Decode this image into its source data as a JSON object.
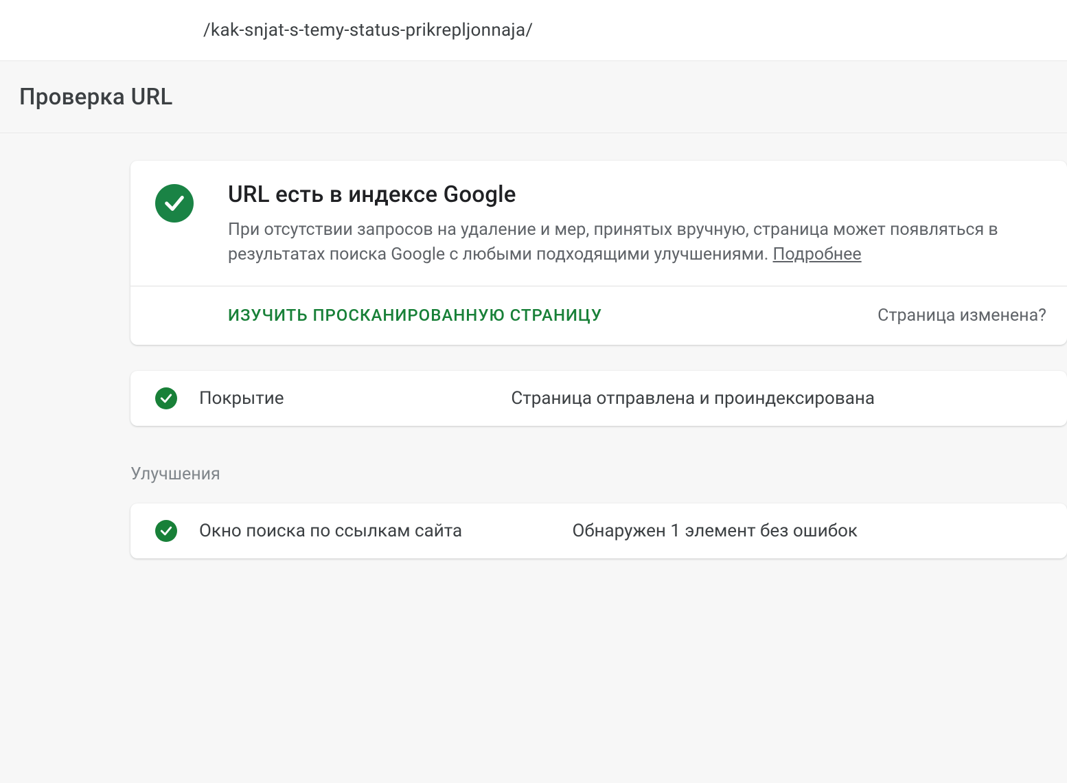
{
  "top_url": "/kak-snjat-s-temy-status-prikrepljonnaja/",
  "header": {
    "title": "Проверка URL"
  },
  "status": {
    "title": "URL есть в индексе Google",
    "description": "При отсутствии запросов на удаление и мер, принятых вручную, страница может появляться в результатах поиска Google с любыми подходящими улучшениями. ",
    "learn_more": "Подробнее"
  },
  "actions": {
    "view_crawled": "ИЗУЧИТЬ ПРОСКАНИРОВАННУЮ СТРАНИЦУ",
    "page_changed": "Страница изменена?"
  },
  "rows": {
    "coverage": {
      "label": "Покрытие",
      "value": "Страница отправлена и проиндексирована"
    },
    "sitelinks": {
      "label": "Окно поиска по ссылкам сайта",
      "value": "Обнаружен 1 элемент без ошибок"
    }
  },
  "sections": {
    "enhancements": "Улучшения"
  },
  "colors": {
    "green": "#188038",
    "green_dark": "#1a8345"
  }
}
